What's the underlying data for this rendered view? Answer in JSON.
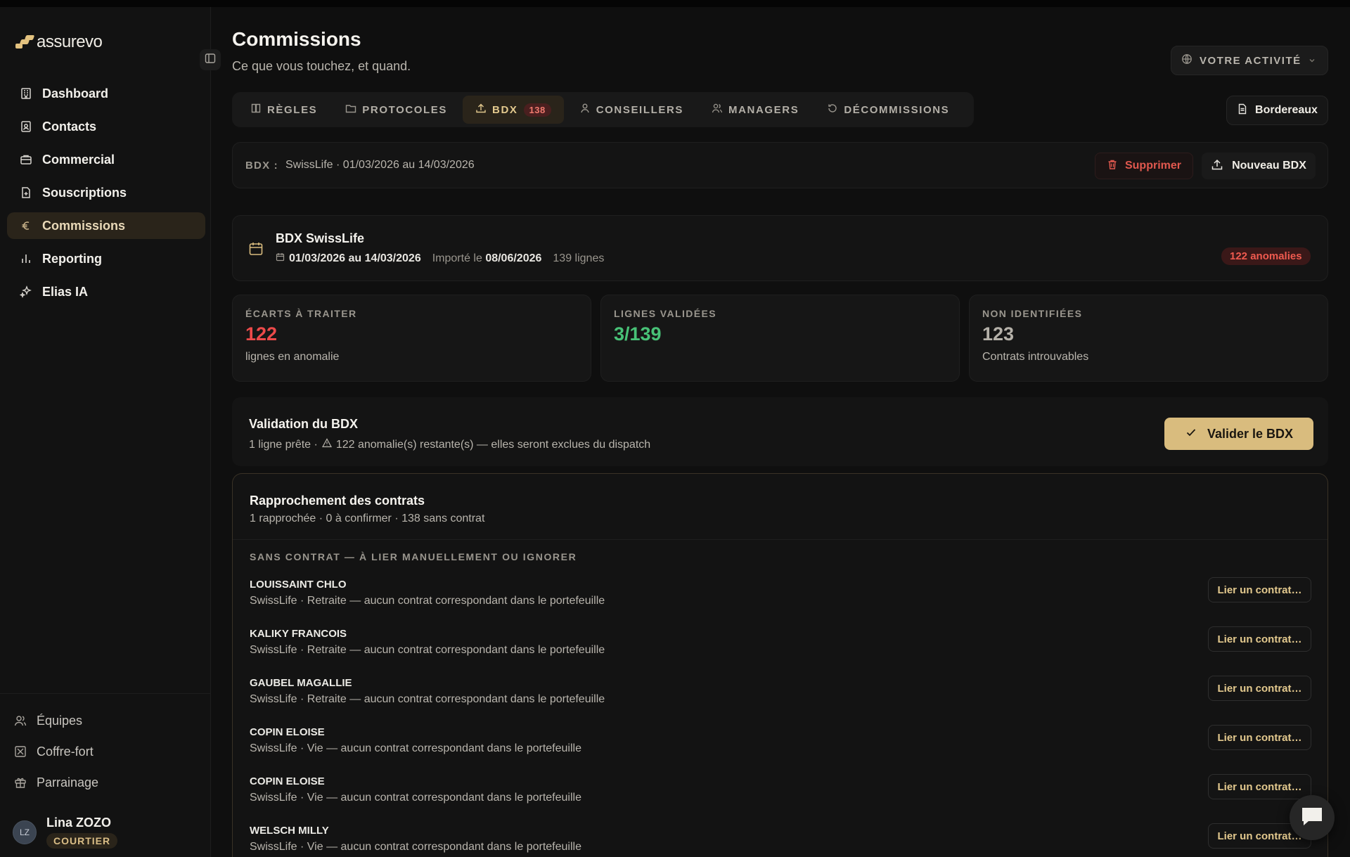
{
  "app": {
    "name": "assurevo",
    "accent": "#d9bc7e"
  },
  "sidebar": {
    "items": [
      {
        "label": "Dashboard",
        "icon": "building-icon"
      },
      {
        "label": "Contacts",
        "icon": "contact-card-icon"
      },
      {
        "label": "Commercial",
        "icon": "briefcase-icon"
      },
      {
        "label": "Souscriptions",
        "icon": "document-plus-icon"
      },
      {
        "label": "Commissions",
        "icon": "euro-icon",
        "active": true
      },
      {
        "label": "Reporting",
        "icon": "bar-chart-icon"
      },
      {
        "label": "Elias IA",
        "icon": "sparkles-icon"
      }
    ],
    "bottom_items": [
      {
        "label": "Équipes",
        "icon": "users-icon"
      },
      {
        "label": "Coffre-fort",
        "icon": "vault-icon"
      },
      {
        "label": "Parrainage",
        "icon": "gift-icon"
      }
    ],
    "user": {
      "initials": "LZ",
      "name": "Lina ZOZO",
      "role": "COURTIER"
    }
  },
  "header": {
    "title": "Commissions",
    "subtitle": "Ce que vous touchez, et quand.",
    "activity_button": "VOTRE ACTIVITÉ"
  },
  "tabs": [
    {
      "label": "RÈGLES",
      "icon": "book-icon"
    },
    {
      "label": "PROTOCOLES",
      "icon": "folder-icon"
    },
    {
      "label": "BDX",
      "icon": "upload-icon",
      "badge": "138",
      "active": true
    },
    {
      "label": "CONSEILLERS",
      "icon": "user-icon"
    },
    {
      "label": "MANAGERS",
      "icon": "users-icon"
    },
    {
      "label": "DÉCOMMISSIONS",
      "icon": "undo-icon"
    }
  ],
  "bordereaux_button": "Bordereaux",
  "bdx_bar": {
    "label": "BDX :",
    "value": "SwissLife · 01/03/2026 au 14/03/2026",
    "delete_label": "Supprimer",
    "new_label": "Nouveau BDX"
  },
  "bdx_card": {
    "title": "BDX SwissLife",
    "period": "01/03/2026 au 14/03/2026",
    "imported_prefix": "Importé le",
    "imported_date": "08/06/2026",
    "lines": "139 lignes",
    "anomalies_badge": "122 anomalies"
  },
  "stats": [
    {
      "label": "ÉCARTS À TRAITER",
      "value": "122",
      "desc": "lignes en anomalie",
      "color": "#ec4a4a"
    },
    {
      "label": "LIGNES VALIDÉES",
      "value": "3/139",
      "desc": "",
      "color": "#48c277"
    },
    {
      "label": "NON IDENTIFIÉES",
      "value": "123",
      "desc": "Contrats introuvables",
      "color": "#b5b1a9"
    }
  ],
  "validation": {
    "title": "Validation du BDX",
    "desc_prefix": "1 ligne prête ·",
    "desc_suffix": "122 anomalie(s) restante(s) — elles seront exclues du dispatch",
    "button": "Valider le BDX"
  },
  "rapprochement": {
    "title": "Rapprochement des contrats",
    "subtitle": "1 rapprochée · 0 à confirmer · 138 sans contrat",
    "section_title": "SANS CONTRAT — À LIER MANUELLEMENT OU IGNORER",
    "link_label": "Lier un contrat…",
    "rows": [
      {
        "name": "LOUISSAINT CHLO",
        "desc": "SwissLife · Retraite — aucun contrat correspondant dans le portefeuille"
      },
      {
        "name": "KALIKY FRANCOIS",
        "desc": "SwissLife · Retraite — aucun contrat correspondant dans le portefeuille"
      },
      {
        "name": "GAUBEL MAGALLIE",
        "desc": "SwissLife · Retraite — aucun contrat correspondant dans le portefeuille"
      },
      {
        "name": "COPIN ELOISE",
        "desc": "SwissLife · Vie — aucun contrat correspondant dans le portefeuille"
      },
      {
        "name": "COPIN ELOISE",
        "desc": "SwissLife · Vie — aucun contrat correspondant dans le portefeuille"
      },
      {
        "name": "WELSCH MILLY",
        "desc": "SwissLife · Vie — aucun contrat correspondant dans le portefeuille"
      }
    ]
  }
}
